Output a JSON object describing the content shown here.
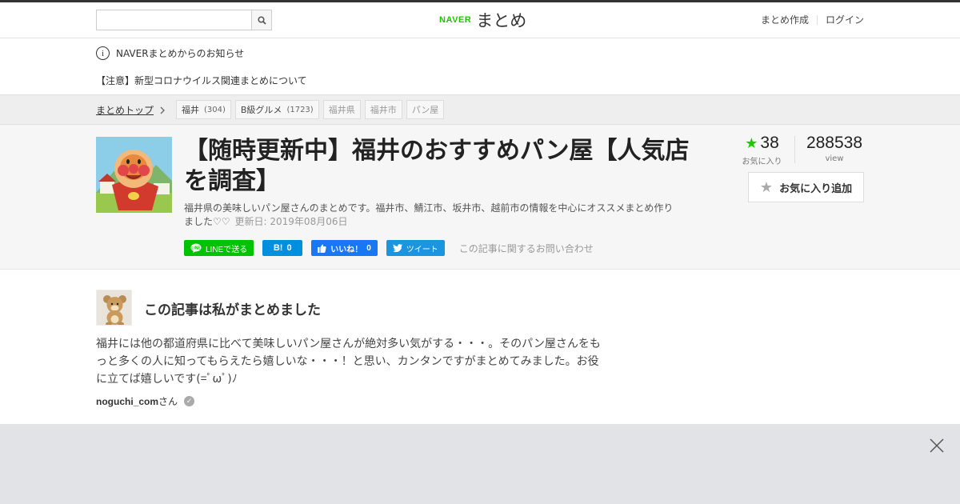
{
  "header": {
    "search": {
      "placeholder": "",
      "value": ""
    },
    "logo_brand": "NAVER",
    "logo_text": "まとめ",
    "links": [
      "まとめ作成",
      "ログイン"
    ]
  },
  "notice": {
    "heading": "NAVERまとめからのお知らせ",
    "link": "【注意】新型コロナウイルス関連まとめについて"
  },
  "breadcrumb": {
    "top": "まとめトップ",
    "tags": [
      {
        "label": "福井",
        "count": "(304)"
      },
      {
        "label": "B級グルメ",
        "count": "(1723)"
      },
      {
        "label": "福井県",
        "count": ""
      },
      {
        "label": "福井市",
        "count": ""
      },
      {
        "label": "パン屋",
        "count": ""
      }
    ]
  },
  "article": {
    "title": "【随時更新中】福井のおすすめパン屋【人気店を調査】",
    "description": "福井県の美味しいパン屋さんのまとめです。福井市、鯖江市、坂井市、越前市の情報を中心にオススメまとめ作りました♡♡",
    "updated": "更新日: 2019年08月06日",
    "share": {
      "line": "LINEで送る",
      "hatena_mark": "B!",
      "hatena_count": "0",
      "fb_label": "いいね！",
      "fb_count": "0",
      "tweet": "ツイート"
    },
    "contact": "この記事に関するお問い合わせ",
    "favorites": "38",
    "favorites_label": "お気に入り",
    "views": "288538",
    "views_label": "view",
    "fav_button": "お気に入り追加"
  },
  "author": {
    "heading": "この記事は私がまとめました",
    "text": "福井には他の都道府県に比べて美味しいパン屋さんが絶対多い気がする・・・。そのパン屋さんをもっと多くの人に知ってもらえたら嬉しいな・・・！と思い、カンタンですがまとめてみました。お役に立てば嬉しいです(=ﾟωﾟ)ﾉ",
    "name": "noguchi_com",
    "suffix": "さん"
  },
  "colors": {
    "naver_green": "#1ec800",
    "line": "#00c300",
    "hatena": "#008fde",
    "facebook": "#1877f2",
    "twitter": "#1b95e0"
  }
}
